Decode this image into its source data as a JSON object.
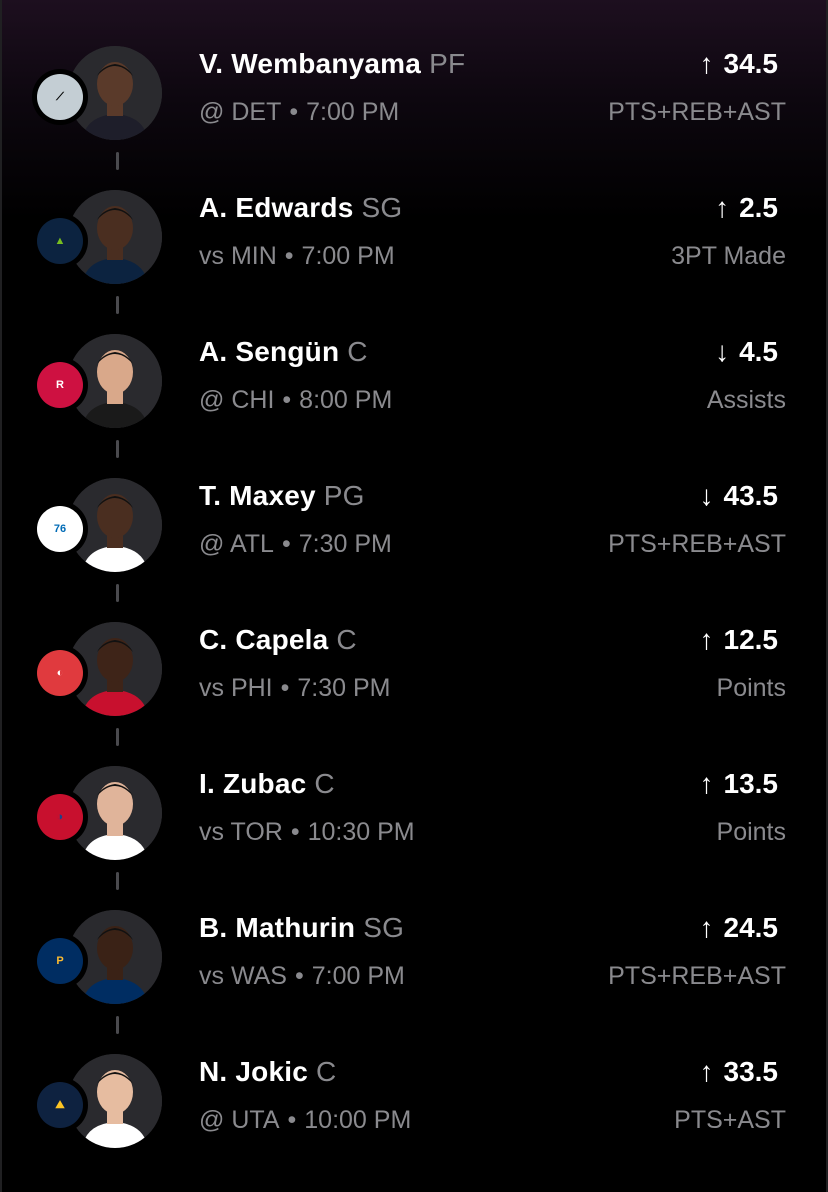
{
  "picks": [
    {
      "player": "V. Wembanyama",
      "position": "PF",
      "venue": "@",
      "opponent": "DET",
      "time": "7:00 PM",
      "direction": "up",
      "arrow": "↑",
      "line": "34.5",
      "stat": "PTS+REB+AST",
      "team_icon": "spurs-logo-icon",
      "team_colors": {
        "bg": "#c4ced4",
        "fg": "#000000"
      },
      "jersey_color": "#1e1e2a",
      "skin_color": "#5a3a2a"
    },
    {
      "player": "A. Edwards",
      "position": "SG",
      "venue": "vs",
      "opponent": "MIN",
      "time": "7:00 PM",
      "direction": "up",
      "arrow": "↑",
      "line": "2.5",
      "stat": "3PT Made",
      "team_icon": "timberwolves-logo-icon",
      "team_colors": {
        "bg": "#0c2340",
        "fg": "#78be20"
      },
      "jersey_color": "#0c2340",
      "skin_color": "#4a2e20"
    },
    {
      "player": "A. Sengün",
      "position": "C",
      "venue": "@",
      "opponent": "CHI",
      "time": "8:00 PM",
      "direction": "down",
      "arrow": "↓",
      "line": "4.5",
      "stat": "Assists",
      "team_icon": "rockets-logo-icon",
      "team_colors": {
        "bg": "#ce1141",
        "fg": "#ffffff"
      },
      "jersey_color": "#1a1a1a",
      "skin_color": "#d9a88a"
    },
    {
      "player": "T. Maxey",
      "position": "PG",
      "venue": "@",
      "opponent": "ATL",
      "time": "7:30 PM",
      "direction": "down",
      "arrow": "↓",
      "line": "43.5",
      "stat": "PTS+REB+AST",
      "team_icon": "76ers-logo-icon",
      "team_colors": {
        "bg": "#ffffff",
        "fg": "#006bb6"
      },
      "jersey_color": "#ffffff",
      "skin_color": "#4a2e20"
    },
    {
      "player": "C. Capela",
      "position": "C",
      "venue": "vs",
      "opponent": "PHI",
      "time": "7:30 PM",
      "direction": "up",
      "arrow": "↑",
      "line": "12.5",
      "stat": "Points",
      "team_icon": "hawks-logo-icon",
      "team_colors": {
        "bg": "#e03a3e",
        "fg": "#ffffff"
      },
      "jersey_color": "#c8102e",
      "skin_color": "#3e2418"
    },
    {
      "player": "I. Zubac",
      "position": "C",
      "venue": "vs",
      "opponent": "TOR",
      "time": "10:30 PM",
      "direction": "up",
      "arrow": "↑",
      "line": "13.5",
      "stat": "Points",
      "team_icon": "clippers-logo-icon",
      "team_colors": {
        "bg": "#c8102e",
        "fg": "#1d428a"
      },
      "jersey_color": "#ffffff",
      "skin_color": "#e0b49a"
    },
    {
      "player": "B. Mathurin",
      "position": "SG",
      "venue": "vs",
      "opponent": "WAS",
      "time": "7:00 PM",
      "direction": "up",
      "arrow": "↑",
      "line": "24.5",
      "stat": "PTS+REB+AST",
      "team_icon": "pacers-logo-icon",
      "team_colors": {
        "bg": "#002d62",
        "fg": "#fdbb30"
      },
      "jersey_color": "#002d62",
      "skin_color": "#3a2216"
    },
    {
      "player": "N. Jokic",
      "position": "C",
      "venue": "@",
      "opponent": "UTA",
      "time": "10:00 PM",
      "direction": "up",
      "arrow": "↑",
      "line": "33.5",
      "stat": "PTS+AST",
      "team_icon": "nuggets-logo-icon",
      "team_colors": {
        "bg": "#0e2240",
        "fg": "#fec524"
      },
      "jersey_color": "#ffffff",
      "skin_color": "#e6bca0"
    }
  ]
}
